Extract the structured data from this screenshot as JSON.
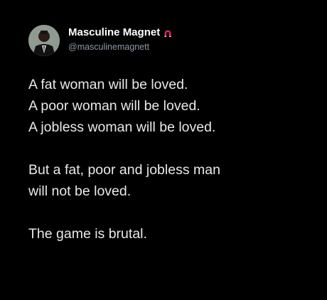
{
  "post": {
    "author": {
      "display_name": "Masculine Magnet",
      "handle": "@masculinemagnett",
      "badge_icon": "magnet-icon",
      "avatar_icon": "suited-man-avatar"
    },
    "body": {
      "paragraph_1": [
        "A fat woman will be loved.",
        "A poor woman will be loved.",
        "A jobless woman will be loved."
      ],
      "paragraph_2": [
        "But a fat, poor and jobless man",
        "will not be loved."
      ],
      "paragraph_3": [
        "The game is brutal."
      ]
    }
  },
  "colors": {
    "background": "#000000",
    "name": "#ffffff",
    "handle": "#8b98a5",
    "text": "#e7e9ea",
    "magnet_red": "#e0245e"
  }
}
